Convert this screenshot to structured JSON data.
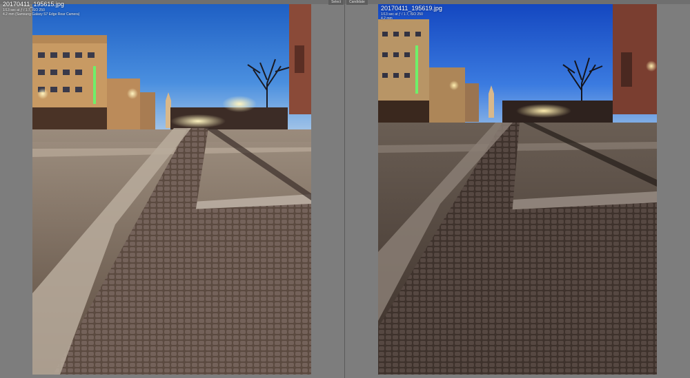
{
  "left": {
    "tag": "Select",
    "filename": "20170411_195615.jpg",
    "exposure": "1/13 sec at ƒ / 1.7, ISO 250",
    "lens": "4.2 mm (Samsung Galaxy S7 Edge Rear Camera)"
  },
  "right": {
    "tag": "Candidate",
    "filename": "20170411_195619.jpg",
    "exposure": "1/13 sec at ƒ / 1.7, ISO 250",
    "lens": "4.2 mm"
  }
}
